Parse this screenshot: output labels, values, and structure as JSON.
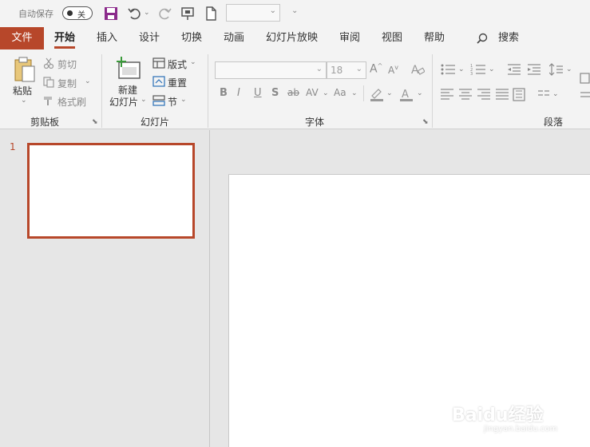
{
  "quick_access": {
    "autosave_label": "自动保存",
    "autosave_state": "关",
    "save_icon": "save-icon",
    "undo_icon": "undo-icon",
    "redo_icon": "redo-icon",
    "present_icon": "present-from-start-icon",
    "new_icon": "new-document-icon",
    "font_combo_value": ""
  },
  "tabs": {
    "file": "文件",
    "home": "开始",
    "insert": "插入",
    "design": "设计",
    "transitions": "切换",
    "animations": "动画",
    "slideshow": "幻灯片放映",
    "review": "审阅",
    "view": "视图",
    "help": "帮助",
    "search": "搜索"
  },
  "ribbon": {
    "clipboard": {
      "label": "剪贴板",
      "paste": "粘贴",
      "cut": "剪切",
      "copy": "复制",
      "format_painter": "格式刷"
    },
    "slides": {
      "label": "幻灯片",
      "new_slide_line1": "新建",
      "new_slide_line2": "幻灯片",
      "layout": "版式",
      "reset": "重置",
      "section": "节"
    },
    "font": {
      "label": "字体",
      "font_name": "",
      "font_size": "18",
      "bold": "B",
      "italic": "I",
      "underline": "U",
      "shadow": "S",
      "strike": "ab",
      "spacing": "AV",
      "case": "Aa"
    },
    "paragraph": {
      "label": "段落"
    }
  },
  "slides_pane": {
    "slides": [
      {
        "number": "1"
      }
    ]
  },
  "watermark": {
    "brand": "Baidu经验",
    "url": "jingyan.baidu.com"
  },
  "colors": {
    "accent": "#b7472a",
    "ribbon_bg": "#f3f3f3",
    "workspace_bg": "#e6e6e6",
    "save_icon": "#8b2a8b"
  }
}
